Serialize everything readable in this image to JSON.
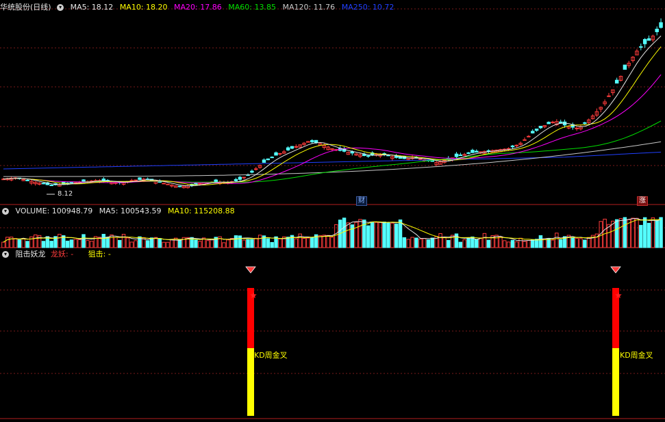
{
  "price_header": {
    "title": "华统股份(日线)",
    "ma5": "MA5: 18.12",
    "ma10": "MA10: 18.20",
    "ma20": "MA20: 17.86",
    "ma60": "MA60: 13.85",
    "ma120": "MA120: 11.76",
    "ma250": "MA250: 10.72"
  },
  "volume_header": {
    "volume": "VOLUME: 100948.79",
    "ma5": "MA5: 100543.59",
    "ma10": "MA10: 115208.88"
  },
  "indicator_header": {
    "name": "阻击妖龙",
    "longyao": "龙妖: -",
    "zuji": "狙击: -"
  },
  "annotations": {
    "low_label": "8.12",
    "cai_badge": "财",
    "zhang_badge": "涨",
    "kd_label_1": "KD周金叉",
    "kd_label_2": "KD周金叉"
  },
  "colors": {
    "up": "#ff3c3c",
    "down": "#54ffff",
    "ma5": "#e6e6e6",
    "ma10": "#ffff00",
    "ma20": "#ff00ff",
    "ma60": "#00e000",
    "ma120": "#c8c8c8",
    "ma250": "#2040ff",
    "signal_red": "#ff0000",
    "signal_yellow": "#ffff00"
  },
  "chart_data": [
    {
      "type": "candlestick",
      "title": "华统股份(日线)",
      "moving_averages": {
        "MA5": 18.12,
        "MA10": 18.2,
        "MA20": 17.86,
        "MA60": 13.85,
        "MA120": 11.76,
        "MA250": 10.72
      },
      "annotated_low": 8.12,
      "close_trend": [
        8.8,
        8.9,
        8.7,
        8.5,
        8.3,
        8.4,
        8.5,
        8.6,
        8.7,
        8.6,
        8.5,
        8.7,
        8.8,
        8.6,
        8.4,
        8.2,
        8.3,
        8.5,
        8.6,
        8.5,
        8.7,
        9.2,
        10.0,
        10.6,
        11.0,
        11.4,
        11.8,
        11.6,
        11.2,
        11.0,
        10.8,
        10.6,
        10.8,
        10.6,
        10.4,
        10.5,
        10.3,
        10.1,
        10.4,
        10.7,
        10.9,
        11.0,
        11.1,
        11.2,
        11.6,
        12.4,
        13.0,
        13.4,
        13.0,
        12.8,
        13.6,
        14.6,
        16.0,
        17.6,
        19.0,
        19.8,
        20.8
      ]
    },
    {
      "type": "bar",
      "title": "VOLUME",
      "values_summary": {
        "VOLUME": 100948.79,
        "MA5": 100543.59,
        "MA10": 115208.88
      }
    },
    {
      "type": "bar",
      "title": "阻击妖龙",
      "signals": [
        {
          "label": "KD周金叉"
        },
        {
          "label": "KD周金叉"
        }
      ]
    }
  ]
}
